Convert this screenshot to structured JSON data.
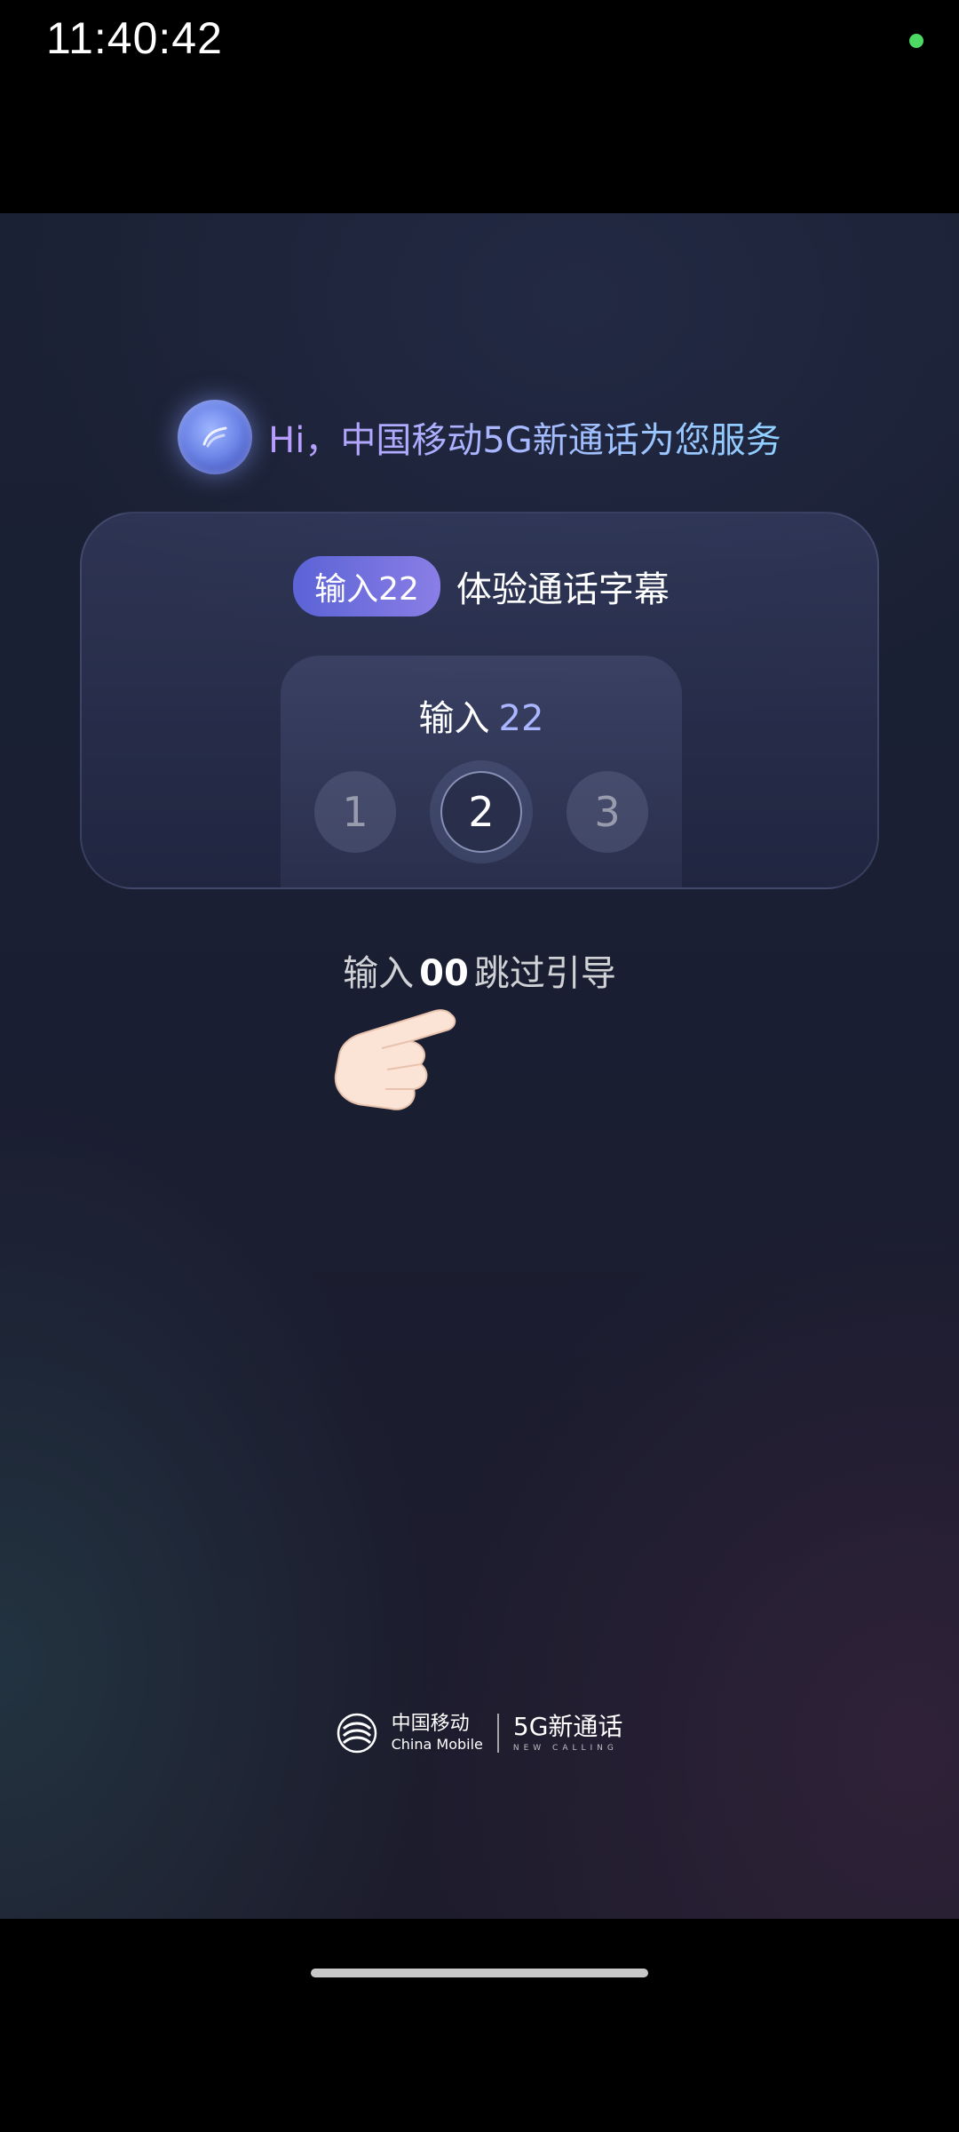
{
  "status_bar": {
    "time": "11:40:42",
    "indicator_color": "#4cd964"
  },
  "greeting": {
    "text": "Hi，中国移动5G新通话为您服务",
    "icon": "assistant-avatar-icon"
  },
  "guide_card": {
    "code_pill": "输入22",
    "title": "体验通话字幕",
    "keypad": {
      "prompt_label": "输入",
      "prompt_code": "22",
      "keys": [
        "1",
        "2",
        "3"
      ],
      "pressed_key": "2",
      "pointer_icon": "hand-pointer-icon"
    }
  },
  "skip_hint": {
    "prefix": "输入",
    "code": "00",
    "suffix": "跳过引导"
  },
  "brand": {
    "operator_zh": "中国移动",
    "operator_en": "China Mobile",
    "service_zh": "5G新通话",
    "service_en": "NEW CALLING",
    "logo_icon": "china-mobile-logo-icon"
  },
  "colors": {
    "accent": "#6d7ee6",
    "pill_start": "#5b63d6",
    "pill_end": "#8a7ee6",
    "code_highlight": "#aab6ff"
  }
}
